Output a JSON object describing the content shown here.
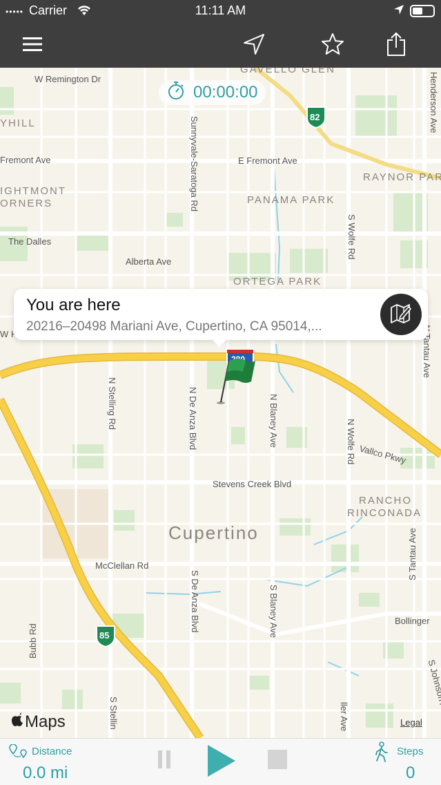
{
  "status_bar": {
    "carrier": "Carrier",
    "time": "11:11 AM",
    "signal_dots": "•••••"
  },
  "nav_bar": {
    "menu_icon": "hamburger-menu-icon",
    "location_icon": "location-arrow-icon",
    "favorite_icon": "star-icon",
    "share_icon": "share-icon"
  },
  "timer": {
    "value": "00:00:00",
    "icon": "stopwatch-icon"
  },
  "callout": {
    "title": "You are here",
    "address": "20216–20498 Mariani Ave, Cupertino, CA  95014,..."
  },
  "map": {
    "street_labels": {
      "w_remington": "W Remington Dr",
      "gavello_glen": "GAVELLO GLEN",
      "henderson": "Henderson Ave",
      "yhill": "YHILL",
      "fremont_w": "Fremont Ave",
      "e_fremont": "E Fremont Ave",
      "sunnyvale_saratoga": "Sunnyvale-Saratoga Rd",
      "raynor": "RAYNOR PAR",
      "lightmont": "IGHTMONT",
      "orners": "ORNERS",
      "panama_park": "PANAMA PARK",
      "s_wolfe": "S Wolfe Rd",
      "the_dalles": "The Dalles",
      "alberta": "Alberta Ave",
      "ortega_park": "ORTEGA PARK",
      "n_tantau": "N Tantau Ave",
      "n_stelling": "N Stelling Rd",
      "n_de_anza": "N De Anza Blvd",
      "n_blaney": "N Blaney Ave",
      "n_wolfe": "N Wolfe Rd",
      "vallco": "Vallco Pkwy",
      "stevens_creek": "Stevens Creek Blvd",
      "rancho": "RANCHO",
      "rinconada": "RINCONADA",
      "cupertino": "Cupertino",
      "s_tantau": "S Tantau Ave",
      "mcclellan": "McClellan Rd",
      "s_de_anza": "S De Anza Blvd",
      "s_blaney": "S Blaney Ave",
      "bollinger": "Bollinger",
      "bubb": "Bubb Rd",
      "s_stelling": "S Stellin",
      "johnson": "S Johnson Ave",
      "miller": "ller Ave",
      "w_h": "W H"
    },
    "shields": {
      "hwy82": "82",
      "hwy280": "280",
      "hwy85": "85"
    },
    "attribution": "Maps",
    "legal": "Legal",
    "colors": {
      "background": "#f6f3ea",
      "highway": "#f7d047",
      "road": "#ffffff",
      "park": "#cfe6bd",
      "water": "#8fd3e8"
    }
  },
  "bottom_bar": {
    "distance_label": "Distance",
    "distance_value": "0.0 mi",
    "steps_label": "Steps",
    "steps_value": "0",
    "pause_icon": "pause-icon",
    "play_icon": "play-icon",
    "stop_icon": "stop-icon",
    "accent": "#2d9fa4"
  }
}
